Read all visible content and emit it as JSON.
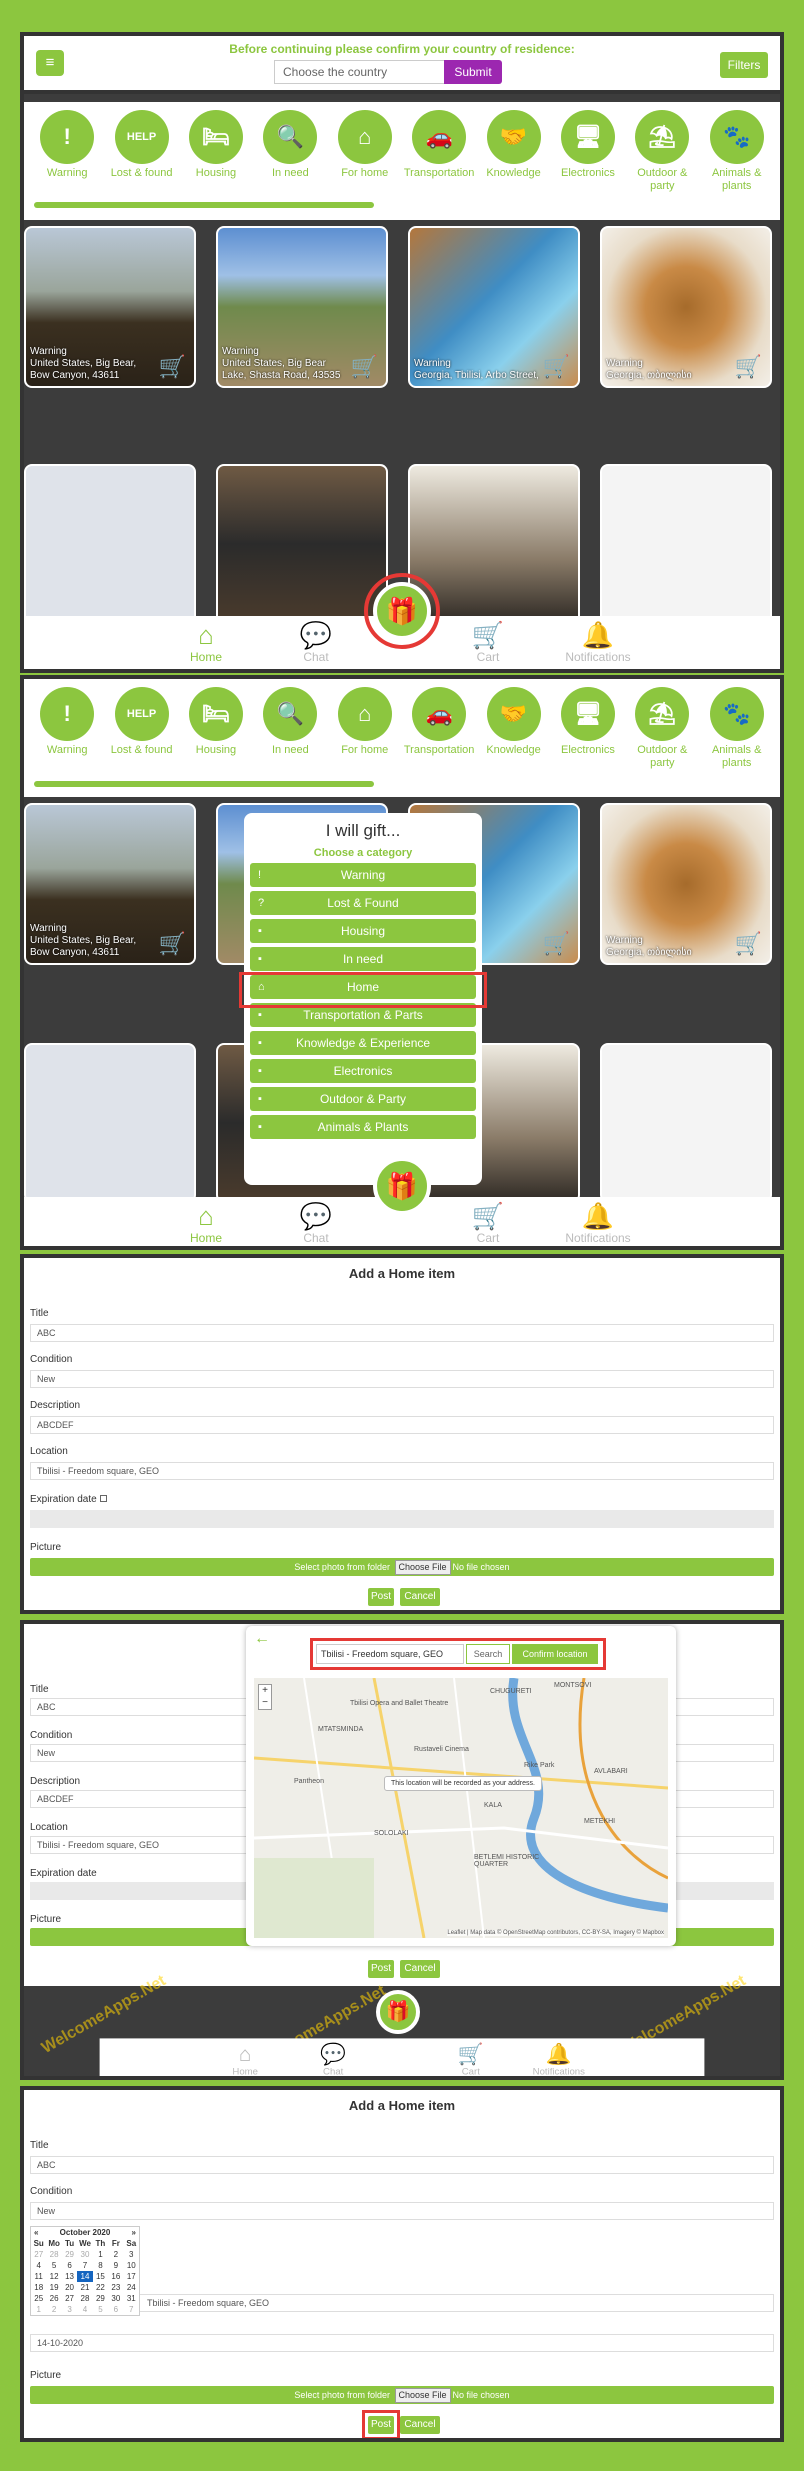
{
  "topbar": {
    "notice": "Before continuing please confirm your country of residence:",
    "country_placeholder": "Choose the country",
    "submit_label": "Submit",
    "filters_label": "Filters",
    "menu_glyph": "≡"
  },
  "categories": [
    {
      "label": "Warning",
      "icon": "warning-icon",
      "glyph": "!"
    },
    {
      "label": "Lost & found",
      "icon": "help-icon",
      "glyph": "HELP"
    },
    {
      "label": "Housing",
      "icon": "housing-icon",
      "glyph": "🛏"
    },
    {
      "label": "In need",
      "icon": "in-need-icon",
      "glyph": "🔍"
    },
    {
      "label": "For home",
      "icon": "home-icon",
      "glyph": "⌂"
    },
    {
      "label": "Transportation",
      "icon": "transport-icon",
      "glyph": "🚗"
    },
    {
      "label": "Knowledge",
      "icon": "knowledge-icon",
      "glyph": "🤝"
    },
    {
      "label": "Electronics",
      "icon": "electronics-icon",
      "glyph": "🖥"
    },
    {
      "label": "Outdoor & party",
      "icon": "outdoor-icon",
      "glyph": "⛱"
    },
    {
      "label": "Animals & plants",
      "icon": "animals-icon",
      "glyph": "🐾"
    }
  ],
  "items": [
    {
      "caption1": "Warning",
      "caption2": "United States, Big Bear,",
      "caption3": "Bow Canyon, 43611"
    },
    {
      "caption1": "Warning",
      "caption2": "United States, Big Bear",
      "caption3": "Lake, Shasta Road, 43535"
    },
    {
      "caption1": "Warning",
      "caption2": "Georgia, Tbilisi, Arbo Street,",
      "caption3": ""
    },
    {
      "caption1": "Warning",
      "caption2": "Georgia, თბილისი",
      "caption3": ""
    }
  ],
  "nav": [
    {
      "label": "Home",
      "glyph": "⌂"
    },
    {
      "label": "Chat",
      "glyph": "💬"
    },
    {
      "label": "Cart",
      "glyph": "🛒"
    },
    {
      "label": "Notifications",
      "glyph": "🔔"
    }
  ],
  "gift_glyph": "🎁",
  "cart_glyph": "🛒",
  "gift_modal": {
    "title": "I will gift...",
    "subtitle": "Choose a category",
    "options": [
      "Warning",
      "Lost & Found",
      "Housing",
      "In need",
      "Home",
      "Transportation & Parts",
      "Knowledge & Experience",
      "Electronics",
      "Outdoor & Party",
      "Animals & Plants"
    ]
  },
  "form": {
    "title": "Add a Home item",
    "title_label": "Title",
    "title_value": "ABC",
    "condition_label": "Condition",
    "condition_value": "New",
    "description_label": "Description",
    "description_value": "ABCDEF",
    "location_label": "Location",
    "location_value": "Tbilisi - Freedom square, GEO",
    "expiration_label": "Expiration date",
    "picture_label": "Picture",
    "select_photo": "Select photo from folder",
    "choose_file": "Choose File",
    "no_file": "No file chosen",
    "post_label": "Post",
    "cancel_label": "Cancel",
    "date_value": "14-10-2020"
  },
  "map_modal": {
    "back_glyph": "←",
    "location_value": "Tbilisi - Freedom square, GEO",
    "search_label": "Search",
    "confirm_label": "Confirm location",
    "tooltip": "This location will be recorded as your address.",
    "attribution": "Leaflet | Map data © OpenStreetMap contributors, CC-BY-SA, Imagery © Mapbox",
    "labels": [
      "Tbilisi Opera and Ballet Theatre",
      "MTATSMINDA",
      "SOLOLAKI",
      "KALA",
      "AVLABARI",
      "METEKHI",
      "BETLEMI HISTORIC QUARTER",
      "CHUGURETI",
      "MONTSOVI",
      "Rustaveli Cinema",
      "Pantheon",
      "Rike Park"
    ]
  },
  "calendar": {
    "month": "October 2020",
    "dows": [
      "Su",
      "Mo",
      "Tu",
      "We",
      "Th",
      "Fr",
      "Sa"
    ],
    "rows": [
      [
        "27",
        "28",
        "29",
        "30",
        "1",
        "2",
        "3"
      ],
      [
        "4",
        "5",
        "6",
        "7",
        "8",
        "9",
        "10"
      ],
      [
        "11",
        "12",
        "13",
        "14",
        "15",
        "16",
        "17"
      ],
      [
        "18",
        "19",
        "20",
        "21",
        "22",
        "23",
        "24"
      ],
      [
        "25",
        "26",
        "27",
        "28",
        "29",
        "30",
        "31"
      ],
      [
        "1",
        "2",
        "3",
        "4",
        "5",
        "6",
        "7"
      ]
    ],
    "selected": "14"
  },
  "watermark": "WelcomeApps.Net",
  "colors": {
    "brand": "#8cc63f",
    "submit": "#9c27b0",
    "highlight": "#e53935"
  }
}
